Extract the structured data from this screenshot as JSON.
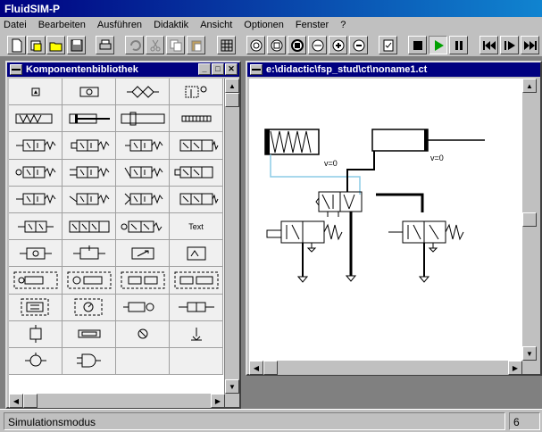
{
  "app": {
    "title": "FluidSIM-P"
  },
  "menu": [
    "Datei",
    "Bearbeiten",
    "Ausführen",
    "Didaktik",
    "Ansicht",
    "Optionen",
    "Fenster",
    "?"
  ],
  "toolbar": {
    "icons": [
      "new-file-icon",
      "open-library-icon",
      "open-file-icon",
      "save-icon",
      "print-icon",
      "undo-icon",
      "cut-icon",
      "copy-icon",
      "paste-icon",
      "grid-icon",
      "zoom-icon",
      "zoom-fit-icon",
      "zoom-window-icon",
      "zoom-all-icon",
      "zoom-in-icon",
      "zoom-out-icon",
      "check-icon",
      "stop-icon",
      "play-icon",
      "pause-icon",
      "rewind-icon",
      "step-icon",
      "fast-forward-icon"
    ]
  },
  "library": {
    "title": "Komponentenbibliothek",
    "text_cell": "Text"
  },
  "circuit": {
    "title": "e:\\didactic\\fsp_stud\\ct\\noname1.ct",
    "label_v1": "v=0",
    "label_v2": "v=0"
  },
  "status": {
    "mode": "Simulationsmodus",
    "extra": "6"
  },
  "colors": {
    "titlebar": "#000080",
    "play": "#00a000",
    "workspace": "#808080"
  }
}
